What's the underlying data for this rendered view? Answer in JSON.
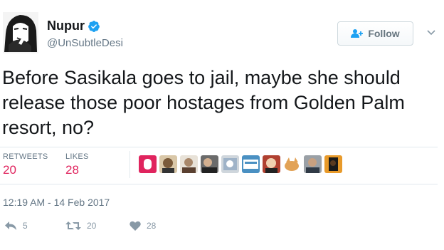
{
  "author": {
    "name": "Nupur",
    "handle": "@UnSubtleDesi"
  },
  "follow_button": {
    "label": "Follow"
  },
  "tweet": {
    "text": "Before Sasikala goes to jail, maybe she should release those poor hostages from Golden Palm resort, no?",
    "timestamp": "12:19 AM - 14 Feb 2017"
  },
  "stats": {
    "retweets_label": "RETWEETS",
    "retweets_value": "20",
    "likes_label": "LIKES",
    "likes_value": "28"
  },
  "actions": {
    "reply_count": "5",
    "retweet_count": "20",
    "like_count": "28"
  },
  "colors": {
    "accent": "#1da1f2",
    "likes": "#e0245e",
    "muted": "#657786"
  },
  "icons": {
    "verified": "verified-badge-icon",
    "follow": "person-plus-icon",
    "caret": "chevron-down-icon",
    "reply": "reply-icon",
    "retweet": "retweet-icon",
    "like": "heart-icon"
  }
}
